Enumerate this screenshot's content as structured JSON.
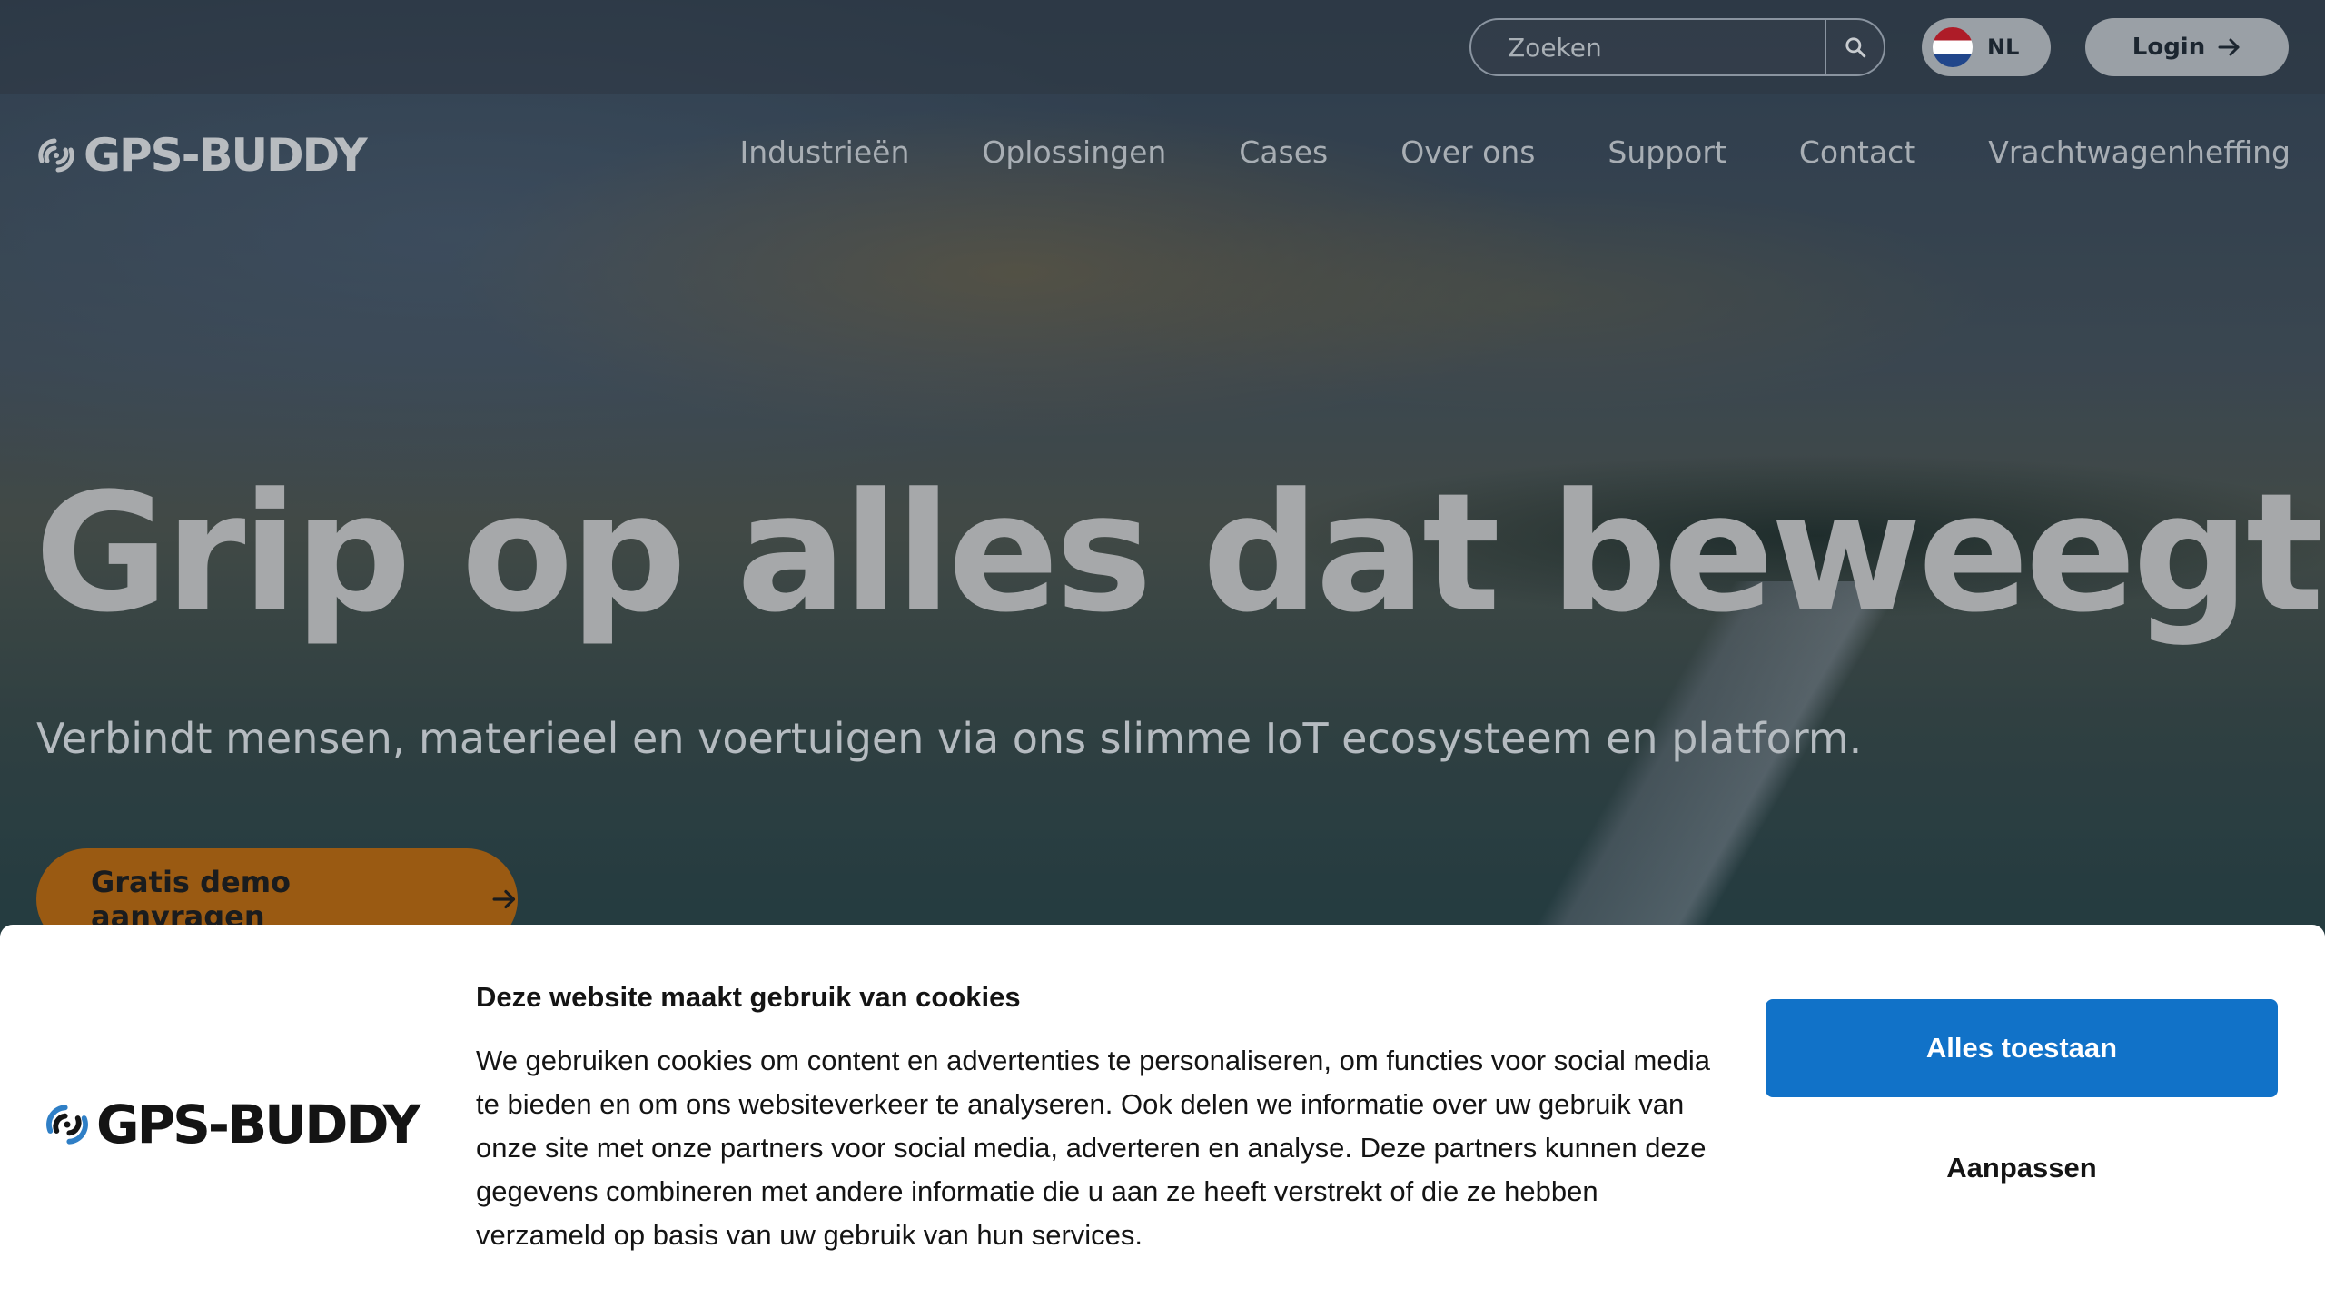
{
  "topbar": {
    "search": {
      "placeholder": "Zoeken"
    },
    "language": {
      "code": "NL"
    },
    "login_label": "Login"
  },
  "brand": {
    "logo_text": "GPS-BUDDY"
  },
  "nav": {
    "items": [
      {
        "label": "Industrieën"
      },
      {
        "label": "Oplossingen"
      },
      {
        "label": "Cases"
      },
      {
        "label": "Over ons"
      },
      {
        "label": "Support"
      },
      {
        "label": "Contact"
      },
      {
        "label": "Vrachtwagenheffing"
      }
    ]
  },
  "hero": {
    "headline": "Grip op alles dat beweegt",
    "subline": "Verbindt mensen, materieel en voertuigen via ons slimme IoT ecosysteem en platform.",
    "cta_label": "Gratis demo aanvragen"
  },
  "cookie_banner": {
    "logo_text": "GPS-BUDDY",
    "title": "Deze website maakt gebruik van cookies",
    "body": "We gebruiken cookies om content en advertenties te personaliseren, om functies voor social media te bieden en om ons websiteverkeer te analyseren. Ook delen we informatie over uw gebruik van onze site met onze partners voor social media, adverteren en analyse. Deze partners kunnen deze gegevens combineren met andere informatie die u aan ze heeft verstrekt of die ze hebben verzameld op basis van uw gebruik van hun services.",
    "accept_label": "Alles toestaan",
    "customize_label": "Aanpassen"
  },
  "colors": {
    "cta_orange": "#9a5a12",
    "accept_blue": "#1172c8",
    "banner_bg": "#ffffff"
  },
  "icons": [
    "search-icon",
    "nl-flag-icon",
    "arrow-right-icon",
    "gps-buddy-logo-icon"
  ]
}
